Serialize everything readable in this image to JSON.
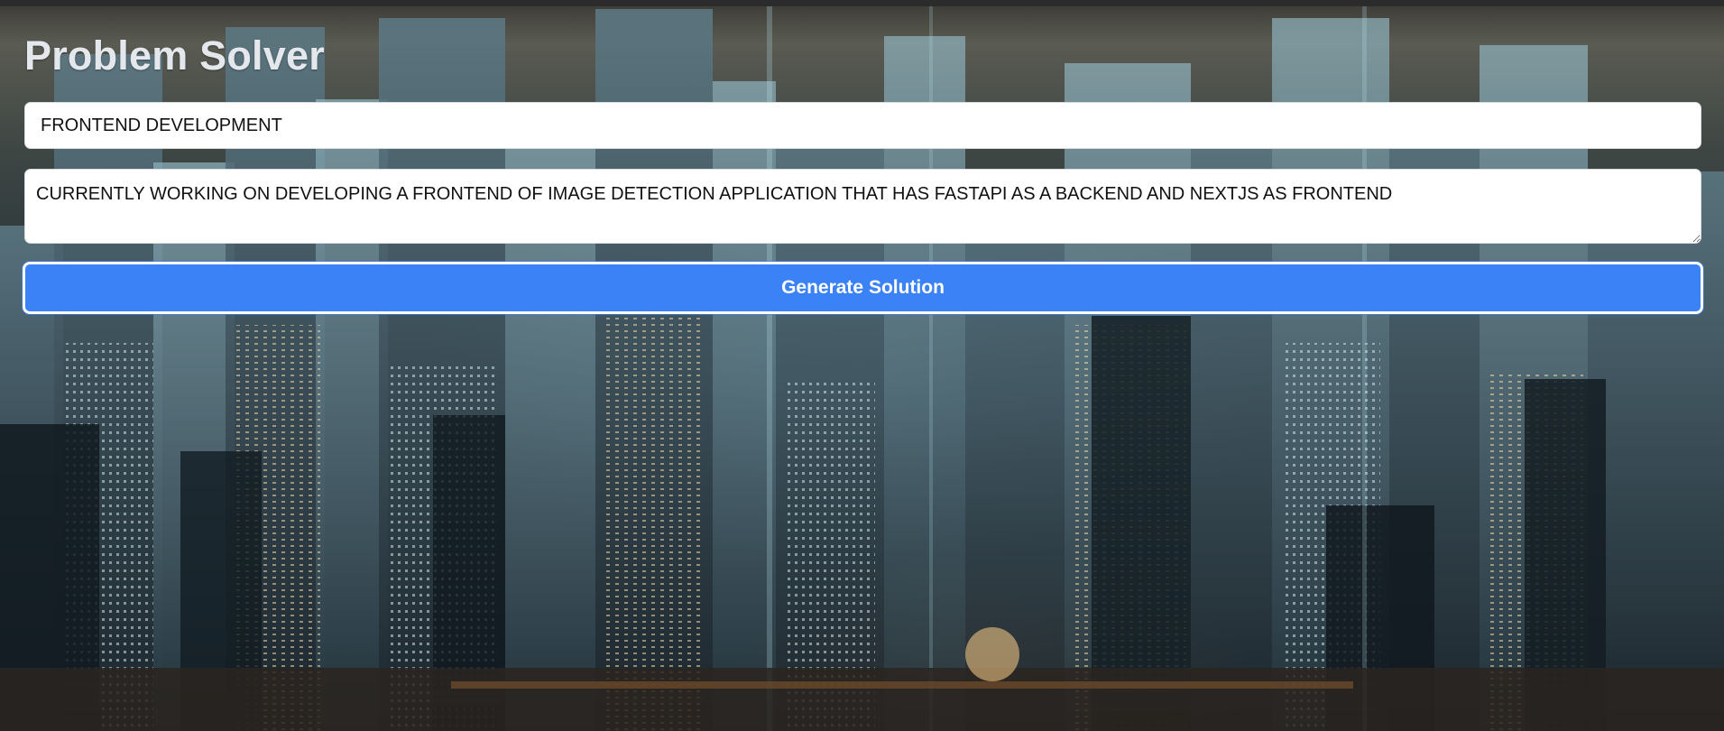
{
  "app": {
    "title": "Problem Solver"
  },
  "form": {
    "topic_value": "FRONTEND DEVELOPMENT",
    "description_value": "CURRENTLY WORKING ON DEVELOPING A FRONTEND OF IMAGE DETECTION APPLICATION THAT HAS FASTAPI AS A BACKEND AND NEXTJS AS FRONTEND",
    "generate_label": "Generate Solution"
  },
  "theme": {
    "button_color": "#3b82f6",
    "title_color": "#e4e8ec",
    "background": "futuristic-city-skyline-image"
  }
}
